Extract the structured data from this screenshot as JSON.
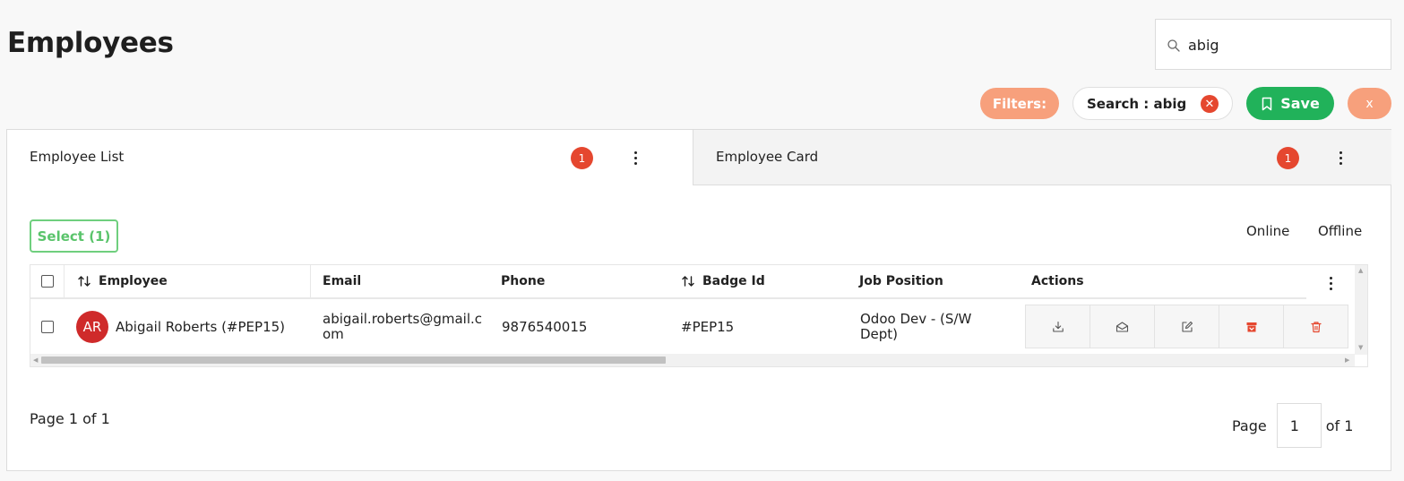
{
  "header": {
    "title": "Employees"
  },
  "search": {
    "value": "abig"
  },
  "filter_bar": {
    "filters_label": "Filters:",
    "active_filter": "Search : abig",
    "save_label": "Save",
    "clear_icon": "x"
  },
  "tabs": [
    {
      "label": "Employee List",
      "count": "1"
    },
    {
      "label": "Employee Card",
      "count": "1"
    }
  ],
  "toolbar": {
    "select_label": "Select (1)",
    "online_label": "Online",
    "offline_label": "Offline"
  },
  "table": {
    "columns": {
      "employee": "Employee",
      "email": "Email",
      "phone": "Phone",
      "badge_id": "Badge Id",
      "job_position": "Job Position",
      "actions": "Actions"
    },
    "rows": [
      {
        "initials": "AR",
        "employee": "Abigail Roberts (#PEP15)",
        "email": "abigail.roberts@gmail.com",
        "phone": "9876540015",
        "badge_id": "#PEP15",
        "job_position": "Odoo Dev - (S/W Dept)"
      }
    ],
    "action_icons": [
      "download-icon",
      "mail-icon",
      "edit-icon",
      "archive-icon",
      "delete-icon"
    ]
  },
  "pagination": {
    "summary": "Page 1 of 1",
    "page_label": "Page",
    "current_page": "1",
    "total_label": "of 1"
  },
  "colors": {
    "accent_orange": "#f7a07c",
    "danger_red": "#e5472f",
    "success_green": "#21b25a",
    "select_green": "#6fcf7e",
    "avatar_red": "#cf2a2a"
  }
}
